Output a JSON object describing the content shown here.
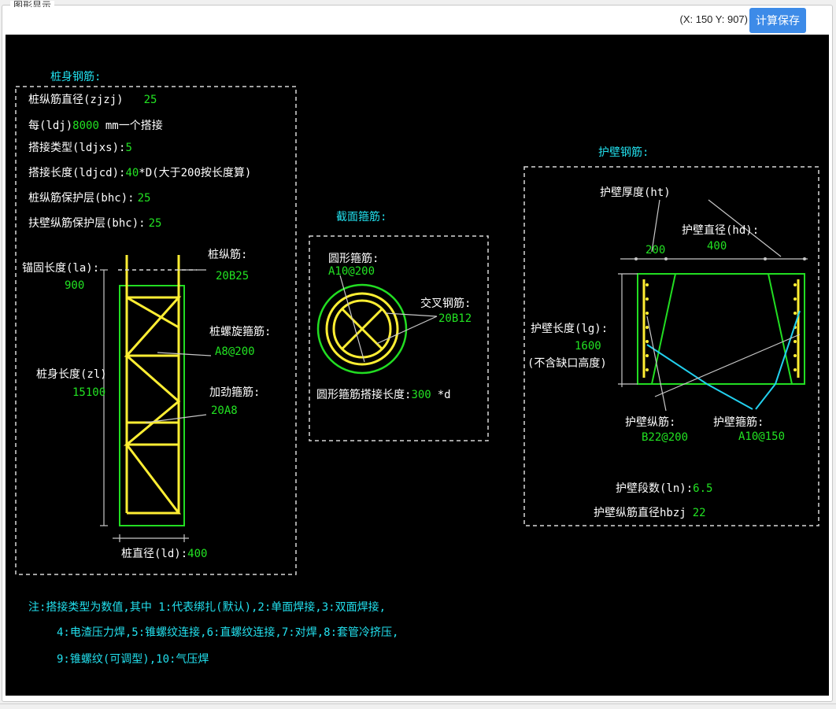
{
  "panel": {
    "title": "图形显示"
  },
  "toolbar": {
    "coords": "(X: 150 Y: 907)",
    "save_label": "计算保存"
  },
  "colors": {
    "canvas_bg": "#000000",
    "label": "#ffffff",
    "value": "#22e222",
    "heading": "#22e0ee",
    "rebar": "#ffee33",
    "frame": "#22dd22",
    "leader": "#c8c8c8",
    "dashed_box": "#d8d8d8",
    "accent_cyan": "#22d0ee",
    "button": "#3d8be8"
  },
  "pile": {
    "heading": "桩身钢筋:",
    "rows": [
      {
        "label": "桩纵筋直径(zjzj)",
        "value": "25",
        "suffix": ""
      },
      {
        "label": "每(ldj)",
        "value": "8000",
        "suffix": "mm一个搭接"
      },
      {
        "label": "搭接类型(ldjxs):",
        "value": "5",
        "suffix": ""
      },
      {
        "label": "搭接长度(ldjcd):",
        "value": "40",
        "suffix": "*D(大于200按长度算)"
      },
      {
        "label": "桩纵筋保护层(bhc):",
        "value": "25",
        "suffix": ""
      },
      {
        "label": "扶壁纵筋保护层(bhc):",
        "value": "25",
        "suffix": ""
      }
    ],
    "anchor_label": "锚固长度(la):",
    "anchor_value": "900",
    "long_bar_label": "桩纵筋:",
    "long_bar_value": "20B25",
    "spiral_label": "桩螺旋箍筋:",
    "spiral_value": "A8@200",
    "length_label": "桩身长度(zl)",
    "length_value": "15100",
    "stiff_label": "加劲箍筋:",
    "stiff_value": "20A8",
    "diameter_label": "桩直径(ld):",
    "diameter_value": "400"
  },
  "section": {
    "heading": "截面箍筋:",
    "circle_label": "圆形箍筋:",
    "circle_value": "A10@200",
    "cross_label": "交叉钢筋:",
    "cross_value": "20B12",
    "lap_label": "圆形箍筋搭接长度:",
    "lap_value": "300",
    "lap_suffix": "*d"
  },
  "wall": {
    "heading": "护壁钢筋:",
    "thickness_label": "护壁厚度(ht)",
    "thickness_value": "200",
    "diameter_label": "护壁直径(hd):",
    "diameter_value": "400",
    "length_label": "护壁长度(lg):",
    "length_value": "1600",
    "length_note": "(不含缺口高度)",
    "long_label": "护壁纵筋:",
    "long_value": "B22@200",
    "stirrup_label": "护壁箍筋:",
    "stirrup_value": "A10@150",
    "segments_label": "护壁段数(ln):",
    "segments_value": "6.5",
    "bar_dia_label": "护壁纵筋直径hbzj",
    "bar_dia_value": "22"
  },
  "notes": [
    "注:搭接类型为数值,其中 1:代表绑扎(默认),2:单面焊接,3:双面焊接,",
    "4:电渣压力焊,5:锥螺纹连接,6:直螺纹连接,7:对焊,8:套管冷挤压,",
    "9:锥螺纹(可调型),10:气压焊"
  ]
}
